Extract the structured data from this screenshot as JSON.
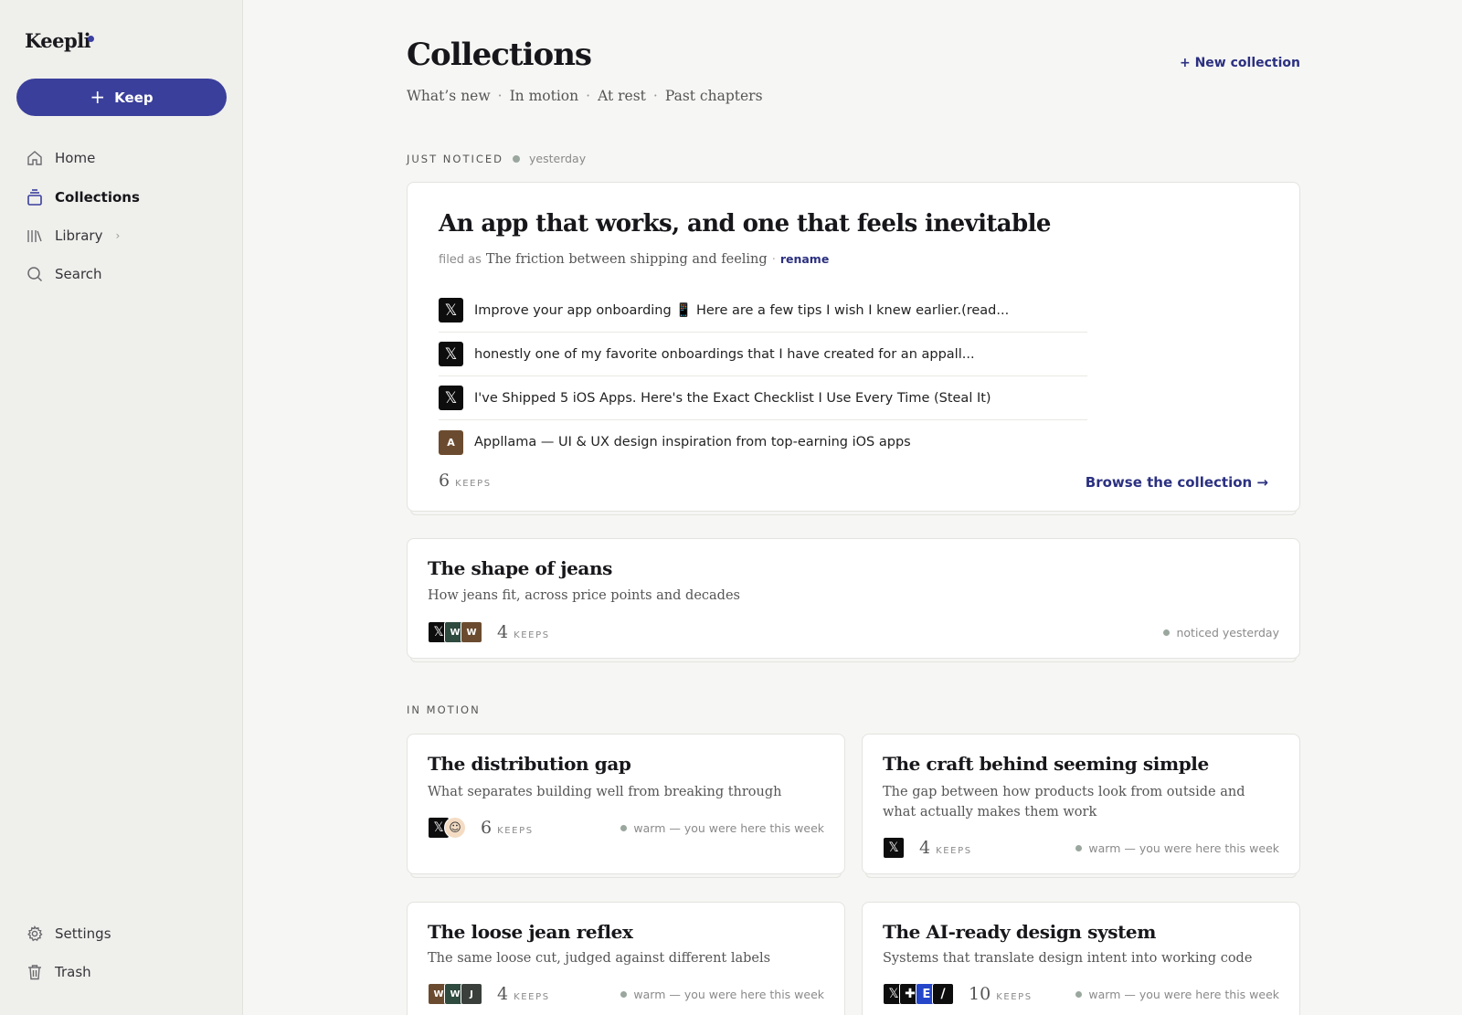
{
  "app": {
    "name": "Keepli"
  },
  "sidebar": {
    "keep_button": "Keep",
    "items": [
      {
        "label": "Home",
        "icon": "home-icon"
      },
      {
        "label": "Collections",
        "icon": "collections-icon",
        "active": true
      },
      {
        "label": "Library",
        "icon": "library-icon"
      },
      {
        "label": "Search",
        "icon": "search-icon"
      }
    ],
    "bottom_items": [
      {
        "label": "Settings",
        "icon": "gear-icon"
      },
      {
        "label": "Trash",
        "icon": "trash-icon"
      }
    ]
  },
  "header": {
    "title": "Collections",
    "new_collection": "+ New collection",
    "tabs": [
      "What’s new",
      "In motion",
      "At rest",
      "Past chapters"
    ]
  },
  "just_noticed": {
    "label": "JUST NOTICED",
    "time": "yesterday",
    "featured": {
      "title": "An app that works, and one that feels inevitable",
      "filed_as_label": "filed as",
      "filed_as": "The friction between shipping and feeling",
      "rename": "rename",
      "keeps": [
        {
          "source": "x",
          "text": "Improve your app onboarding 📱 Here are a few tips I wish I knew earlier.(read..."
        },
        {
          "source": "x",
          "text": "honestly one of my favorite onboardings that I have created for an appall..."
        },
        {
          "source": "x",
          "text": "I've Shipped 5 iOS Apps. Here's the Exact Checklist I Use Every Time (Steal It)"
        },
        {
          "source": "A",
          "text": "Appllama — UI & UX design inspiration from top-earning iOS apps"
        }
      ],
      "count": "6",
      "count_label": "KEEPS",
      "browse": "Browse the collection →"
    },
    "second": {
      "title": "The shape of jeans",
      "subtitle": "How jeans fit, across price points and decades",
      "count": "4",
      "count_label": "KEEPS",
      "status": "noticed yesterday"
    }
  },
  "in_motion": {
    "label": "IN MOTION",
    "cards": [
      {
        "title": "The distribution gap",
        "subtitle": "What separates building well from breaking through",
        "count": "6",
        "count_label": "KEEPS",
        "status": "warm — you were here this week"
      },
      {
        "title": "The craft behind seeming simple",
        "subtitle": "The gap between how products look from outside and what actually makes them work",
        "count": "4",
        "count_label": "KEEPS",
        "status": "warm — you were here this week"
      },
      {
        "title": "The loose jean reflex",
        "subtitle": "The same loose cut, judged against different labels",
        "count": "4",
        "count_label": "KEEPS",
        "status": "warm — you were here this week"
      },
      {
        "title": "The AI-ready design system",
        "subtitle": "Systems that translate design intent into working code",
        "count": "10",
        "count_label": "KEEPS",
        "status": "warm — you were here this week"
      }
    ]
  },
  "avatar_letters": {
    "x": "𝕏",
    "w": "W",
    "j": "J",
    "a": "A",
    "e": "E",
    "plus": "✚",
    "slash": "/",
    "face": "☺"
  },
  "colors": {
    "accent": "#3a3f9b",
    "link": "#2b3080",
    "status_dot": "#9aa79e"
  }
}
